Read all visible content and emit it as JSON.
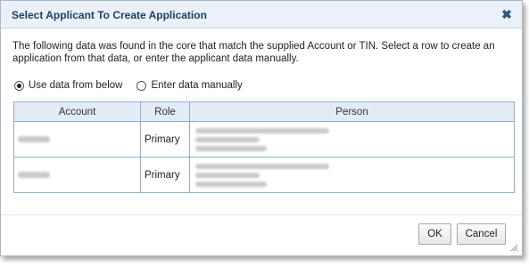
{
  "dialog": {
    "title": "Select Applicant To Create Application",
    "close_icon": "close-icon",
    "message": "The following data was found in the core that match the supplied Account or TIN. Select a row to create an application from that data, or enter the applicant data manually."
  },
  "options": {
    "use_data": "Use data from below",
    "enter_manually": "Enter data manually",
    "selected": "use_data"
  },
  "table": {
    "headers": {
      "account": "Account",
      "role": "Role",
      "person": "Person"
    },
    "rows": [
      {
        "role": "Primary"
      },
      {
        "role": "Primary"
      }
    ]
  },
  "buttons": {
    "ok": "OK",
    "cancel": "Cancel"
  }
}
